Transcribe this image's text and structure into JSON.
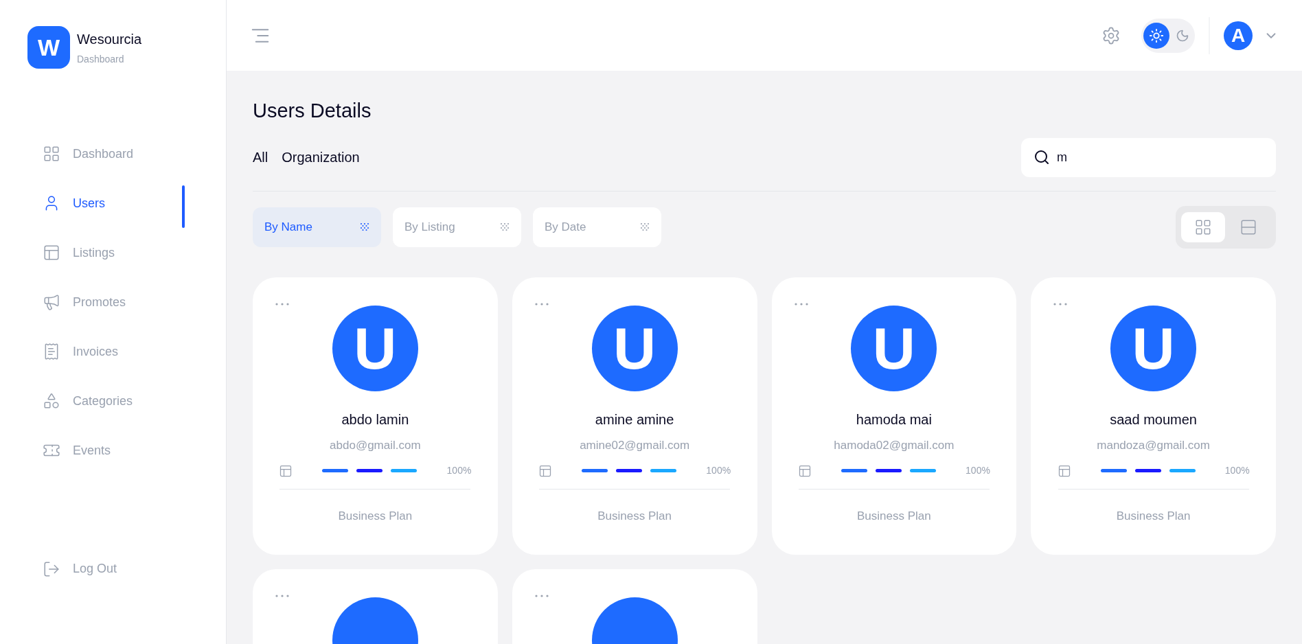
{
  "brand": {
    "logo_letter": "W",
    "name": "Wesourcia",
    "subtitle": "Dashboard"
  },
  "sidebar": {
    "items": [
      {
        "label": "Dashboard",
        "selected": false
      },
      {
        "label": "Users",
        "selected": true
      },
      {
        "label": "Listings",
        "selected": false
      },
      {
        "label": "Promotes",
        "selected": false
      },
      {
        "label": "Invoices",
        "selected": false
      },
      {
        "label": "Categories",
        "selected": false
      },
      {
        "label": "Events",
        "selected": false
      }
    ],
    "logout": "Log Out"
  },
  "header": {
    "theme": {
      "light_selected": true
    },
    "avatar_letter": "A"
  },
  "page": {
    "title": "Users Details",
    "tabs": [
      {
        "label": "All"
      },
      {
        "label": "Organization"
      }
    ],
    "search": {
      "value": "m"
    },
    "filters": [
      {
        "label": "By Name",
        "selected": true
      },
      {
        "label": "By Listing",
        "selected": false
      },
      {
        "label": "By Date",
        "selected": false
      }
    ],
    "view": {
      "grid_selected": true
    }
  },
  "cards": [
    {
      "kind": "user",
      "avatar_letter": "U",
      "name": "abdo lamin",
      "email": "abdo@gmail.com",
      "segments": [
        {
          "color": "#1e6bff"
        },
        {
          "color": "#1a1aff"
        },
        {
          "color": "#1aa8ff"
        }
      ],
      "reading": "100%",
      "plan": "Business Plan"
    },
    {
      "kind": "user",
      "avatar_letter": "U",
      "name": "amine amine",
      "email": "amine02@gmail.com",
      "segments": [
        {
          "color": "#1e6bff"
        },
        {
          "color": "#1a1aff"
        },
        {
          "color": "#1aa8ff"
        }
      ],
      "reading": "100%",
      "plan": "Business Plan"
    },
    {
      "kind": "user",
      "avatar_letter": "U",
      "name": "hamoda mai",
      "email": "hamoda02@gmail.com",
      "segments": [
        {
          "color": "#1e6bff"
        },
        {
          "color": "#1a1aff"
        },
        {
          "color": "#1aa8ff"
        }
      ],
      "reading": "100%",
      "plan": "Business Plan"
    },
    {
      "kind": "user",
      "avatar_letter": "U",
      "name": "saad moumen",
      "email": "mandoza@gmail.com",
      "segments": [
        {
          "color": "#1e6bff"
        },
        {
          "color": "#1a1aff"
        },
        {
          "color": "#1aa8ff"
        }
      ],
      "reading": "100%",
      "plan": "Business Plan"
    },
    {
      "kind": "avatar_only"
    },
    {
      "kind": "avatar_only"
    }
  ]
}
